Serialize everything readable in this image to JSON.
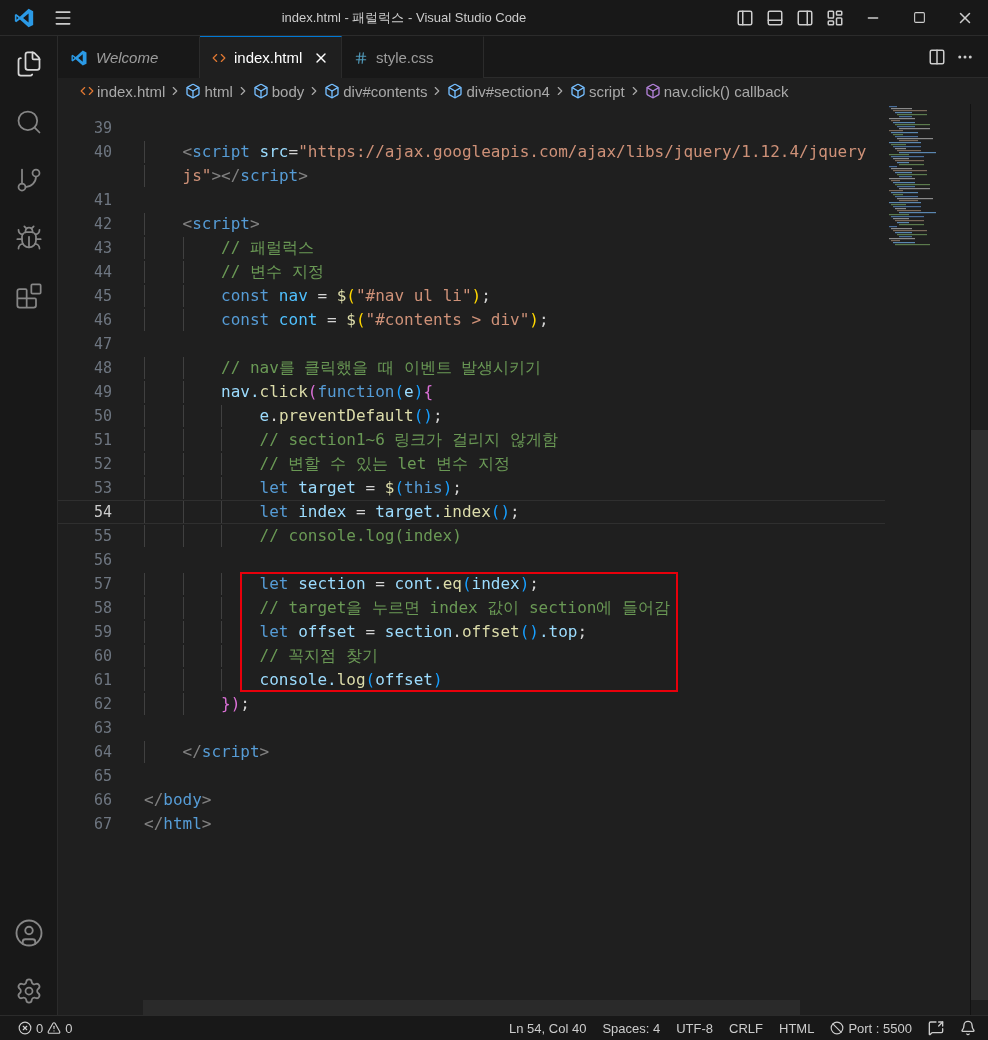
{
  "window": {
    "title": "index.html - 패럴럭스 - Visual Studio Code"
  },
  "tabs": [
    {
      "label": "Welcome",
      "kind": "welcome",
      "selected": false,
      "italic": true
    },
    {
      "label": "index.html",
      "kind": "html",
      "selected": true,
      "italic": false
    },
    {
      "label": "style.css",
      "kind": "css",
      "selected": false,
      "italic": false
    }
  ],
  "breadcrumb": [
    {
      "label": "index.html",
      "kind": "file"
    },
    {
      "label": "html",
      "kind": "element"
    },
    {
      "label": "body",
      "kind": "element"
    },
    {
      "label": "div#contents",
      "kind": "element"
    },
    {
      "label": "div#section4",
      "kind": "element"
    },
    {
      "label": "script",
      "kind": "element"
    },
    {
      "label": "nav.click() callback",
      "kind": "function"
    }
  ],
  "lines": [
    {
      "number": "39",
      "current": false,
      "boxed": false
    },
    {
      "number": "40",
      "current": false,
      "boxed": false,
      "tokens": [
        {
          "t": "    <",
          "color": "#808080"
        },
        {
          "t": "script",
          "color": "#569cd6"
        },
        {
          "t": " src",
          "color": "#9cdcfe"
        },
        {
          "t": "=",
          "color": "#d4d4d4"
        },
        {
          "t": "\"https://ajax.googleapis.com/ajax/libs/jquery/1.12.4/jquery",
          "color": "#ce9178"
        }
      ],
      "wrapped": [
        {
          "t": "js\"",
          "color": "#ce9178"
        },
        {
          "t": "></",
          "color": "#808080"
        },
        {
          "t": "script",
          "color": "#569cd6"
        },
        {
          "t": ">",
          "color": "#808080"
        }
      ]
    },
    {
      "number": "41",
      "current": false,
      "boxed": false
    },
    {
      "number": "42",
      "current": false,
      "boxed": false,
      "tokens": [
        {
          "t": "    <",
          "color": "#808080"
        },
        {
          "t": "script",
          "color": "#569cd6"
        },
        {
          "t": ">",
          "color": "#808080"
        }
      ]
    },
    {
      "number": "43",
      "current": false,
      "boxed": false,
      "tokens": [
        {
          "t": "        // 패럴럭스",
          "color": "#6a9955"
        }
      ]
    },
    {
      "number": "44",
      "current": false,
      "boxed": false,
      "tokens": [
        {
          "t": "        // 변수 지정",
          "color": "#6a9955"
        }
      ]
    },
    {
      "number": "45",
      "current": false,
      "boxed": false,
      "tokens": [
        {
          "t": "        const",
          "color": "#569cd6"
        },
        {
          "t": " nav",
          "color": "#4fc1ff"
        },
        {
          "t": " =",
          "color": "#d4d4d4"
        },
        {
          "t": " $",
          "color": "#dcdcaa"
        },
        {
          "t": "(",
          "color": "#ffd700"
        },
        {
          "t": "\"#nav ul li\"",
          "color": "#ce9178"
        },
        {
          "t": ")",
          "color": "#ffd700"
        },
        {
          "t": ";",
          "color": "#d4d4d4"
        }
      ]
    },
    {
      "number": "46",
      "current": false,
      "boxed": false,
      "tokens": [
        {
          "t": "        const",
          "color": "#569cd6"
        },
        {
          "t": " cont",
          "color": "#4fc1ff"
        },
        {
          "t": " =",
          "color": "#d4d4d4"
        },
        {
          "t": " $",
          "color": "#dcdcaa"
        },
        {
          "t": "(",
          "color": "#ffd700"
        },
        {
          "t": "\"#contents > div\"",
          "color": "#ce9178"
        },
        {
          "t": ")",
          "color": "#ffd700"
        },
        {
          "t": ";",
          "color": "#d4d4d4"
        }
      ]
    },
    {
      "number": "47",
      "current": false,
      "boxed": false
    },
    {
      "number": "48",
      "current": false,
      "boxed": false,
      "tokens": [
        {
          "t": "        // nav를 클릭했을 때 이벤트 발생시키기",
          "color": "#6a9955"
        }
      ]
    },
    {
      "number": "49",
      "current": false,
      "boxed": false,
      "tokens": [
        {
          "t": "        nav.",
          "color": "#9cdcfe"
        },
        {
          "t": "click",
          "color": "#dcdcaa"
        },
        {
          "t": "(",
          "color": "#da70d6"
        },
        {
          "t": "function",
          "color": "#569cd6"
        },
        {
          "t": "(",
          "color": "#179fff"
        },
        {
          "t": "e",
          "color": "#9cdcfe"
        },
        {
          "t": ")",
          "color": "#179fff"
        },
        {
          "t": "{",
          "color": "#da70d6"
        }
      ]
    },
    {
      "number": "50",
      "current": false,
      "boxed": false,
      "tokens": [
        {
          "t": "            e",
          "color": "#9cdcfe"
        },
        {
          "t": ".",
          "color": "#d4d4d4"
        },
        {
          "t": "preventDefault",
          "color": "#dcdcaa"
        },
        {
          "t": "()",
          "color": "#179fff"
        },
        {
          "t": ";",
          "color": "#d4d4d4"
        }
      ]
    },
    {
      "number": "51",
      "current": false,
      "boxed": false,
      "tokens": [
        {
          "t": "            // section1~6 링크가 걸리지 않게함",
          "color": "#6a9955"
        }
      ]
    },
    {
      "number": "52",
      "current": false,
      "boxed": false,
      "tokens": [
        {
          "t": "            // 변할 수 있는 let 변수 지정",
          "color": "#6a9955"
        }
      ]
    },
    {
      "number": "53",
      "current": false,
      "boxed": false,
      "tokens": [
        {
          "t": "            let",
          "color": "#569cd6"
        },
        {
          "t": " target",
          "color": "#9cdcfe"
        },
        {
          "t": " =",
          "color": "#d4d4d4"
        },
        {
          "t": " $",
          "color": "#dcdcaa"
        },
        {
          "t": "(",
          "color": "#179fff"
        },
        {
          "t": "this",
          "color": "#569cd6"
        },
        {
          "t": ")",
          "color": "#179fff"
        },
        {
          "t": ";",
          "color": "#d4d4d4"
        }
      ]
    },
    {
      "number": "54",
      "current": true,
      "boxed": false,
      "tokens": [
        {
          "t": "            let",
          "color": "#569cd6"
        },
        {
          "t": " index",
          "color": "#9cdcfe"
        },
        {
          "t": " =",
          "color": "#d4d4d4"
        },
        {
          "t": " target.",
          "color": "#9cdcfe"
        },
        {
          "t": "index",
          "color": "#dcdcaa"
        },
        {
          "t": "()",
          "color": "#179fff"
        },
        {
          "t": ";",
          "color": "#d4d4d4"
        }
      ]
    },
    {
      "number": "55",
      "current": false,
      "boxed": false,
      "tokens": [
        {
          "t": "            // console.log(index)",
          "color": "#6a9955"
        }
      ]
    },
    {
      "number": "56",
      "current": false,
      "boxed": false
    },
    {
      "number": "57",
      "current": false,
      "boxed": true,
      "tokens": [
        {
          "t": "            let",
          "color": "#569cd6"
        },
        {
          "t": " section",
          "color": "#9cdcfe"
        },
        {
          "t": " =",
          "color": "#d4d4d4"
        },
        {
          "t": " cont.",
          "color": "#9cdcfe"
        },
        {
          "t": "eq",
          "color": "#dcdcaa"
        },
        {
          "t": "(",
          "color": "#179fff"
        },
        {
          "t": "index",
          "color": "#9cdcfe"
        },
        {
          "t": ")",
          "color": "#179fff"
        },
        {
          "t": ";",
          "color": "#d4d4d4"
        }
      ]
    },
    {
      "number": "58",
      "current": false,
      "boxed": true,
      "tokens": [
        {
          "t": "            // target을 누르면 index 값이 section에 들어감",
          "color": "#6a9955"
        }
      ]
    },
    {
      "number": "59",
      "current": false,
      "boxed": true,
      "tokens": [
        {
          "t": "            let",
          "color": "#569cd6"
        },
        {
          "t": " offset",
          "color": "#9cdcfe"
        },
        {
          "t": " =",
          "color": "#d4d4d4"
        },
        {
          "t": " section",
          "color": "#9cdcfe"
        },
        {
          "t": ".",
          "color": "#d4d4d4"
        },
        {
          "t": "offset",
          "color": "#dcdcaa"
        },
        {
          "t": "()",
          "color": "#179fff"
        },
        {
          "t": ".top",
          "color": "#9cdcfe"
        },
        {
          "t": ";",
          "color": "#d4d4d4"
        }
      ]
    },
    {
      "number": "60",
      "current": false,
      "boxed": true,
      "tokens": [
        {
          "t": "            // 꼭지점 찾기",
          "color": "#6a9955"
        }
      ]
    },
    {
      "number": "61",
      "current": false,
      "boxed": true,
      "tokens": [
        {
          "t": "            console.",
          "color": "#9cdcfe"
        },
        {
          "t": "log",
          "color": "#dcdcaa"
        },
        {
          "t": "(",
          "color": "#179fff"
        },
        {
          "t": "offset",
          "color": "#9cdcfe"
        },
        {
          "t": ")",
          "color": "#179fff"
        }
      ]
    },
    {
      "number": "62",
      "current": false,
      "boxed": false,
      "tokens": [
        {
          "t": "        }",
          "color": "#da70d6"
        },
        {
          "t": ")",
          "color": "#da70d6"
        },
        {
          "t": ";",
          "color": "#d4d4d4"
        }
      ]
    },
    {
      "number": "63",
      "current": false,
      "boxed": false
    },
    {
      "number": "64",
      "current": false,
      "boxed": false,
      "tokens": [
        {
          "t": "    </",
          "color": "#808080"
        },
        {
          "t": "script",
          "color": "#569cd6"
        },
        {
          "t": ">",
          "color": "#808080"
        }
      ]
    },
    {
      "number": "65",
      "current": false,
      "boxed": false
    },
    {
      "number": "66",
      "current": false,
      "boxed": false,
      "tokens": [
        {
          "t": "</",
          "color": "#808080"
        },
        {
          "t": "body",
          "color": "#569cd6"
        },
        {
          "t": ">",
          "color": "#808080"
        }
      ]
    },
    {
      "number": "67",
      "current": false,
      "boxed": false,
      "tokens": [
        {
          "t": "</",
          "color": "#808080"
        },
        {
          "t": "html",
          "color": "#569cd6"
        },
        {
          "t": ">",
          "color": "#808080"
        }
      ]
    }
  ],
  "status_bar": {
    "errors": "0",
    "warnings": "0",
    "items": [
      {
        "label": "Ln 54, Col 40",
        "kind": "text"
      },
      {
        "label": "Spaces: 4",
        "kind": "text"
      },
      {
        "label": "UTF-8",
        "kind": "text"
      },
      {
        "label": "CRLF",
        "kind": "text"
      },
      {
        "label": "HTML",
        "kind": "text"
      },
      {
        "label": "Port : 5500",
        "kind": "port"
      }
    ]
  }
}
